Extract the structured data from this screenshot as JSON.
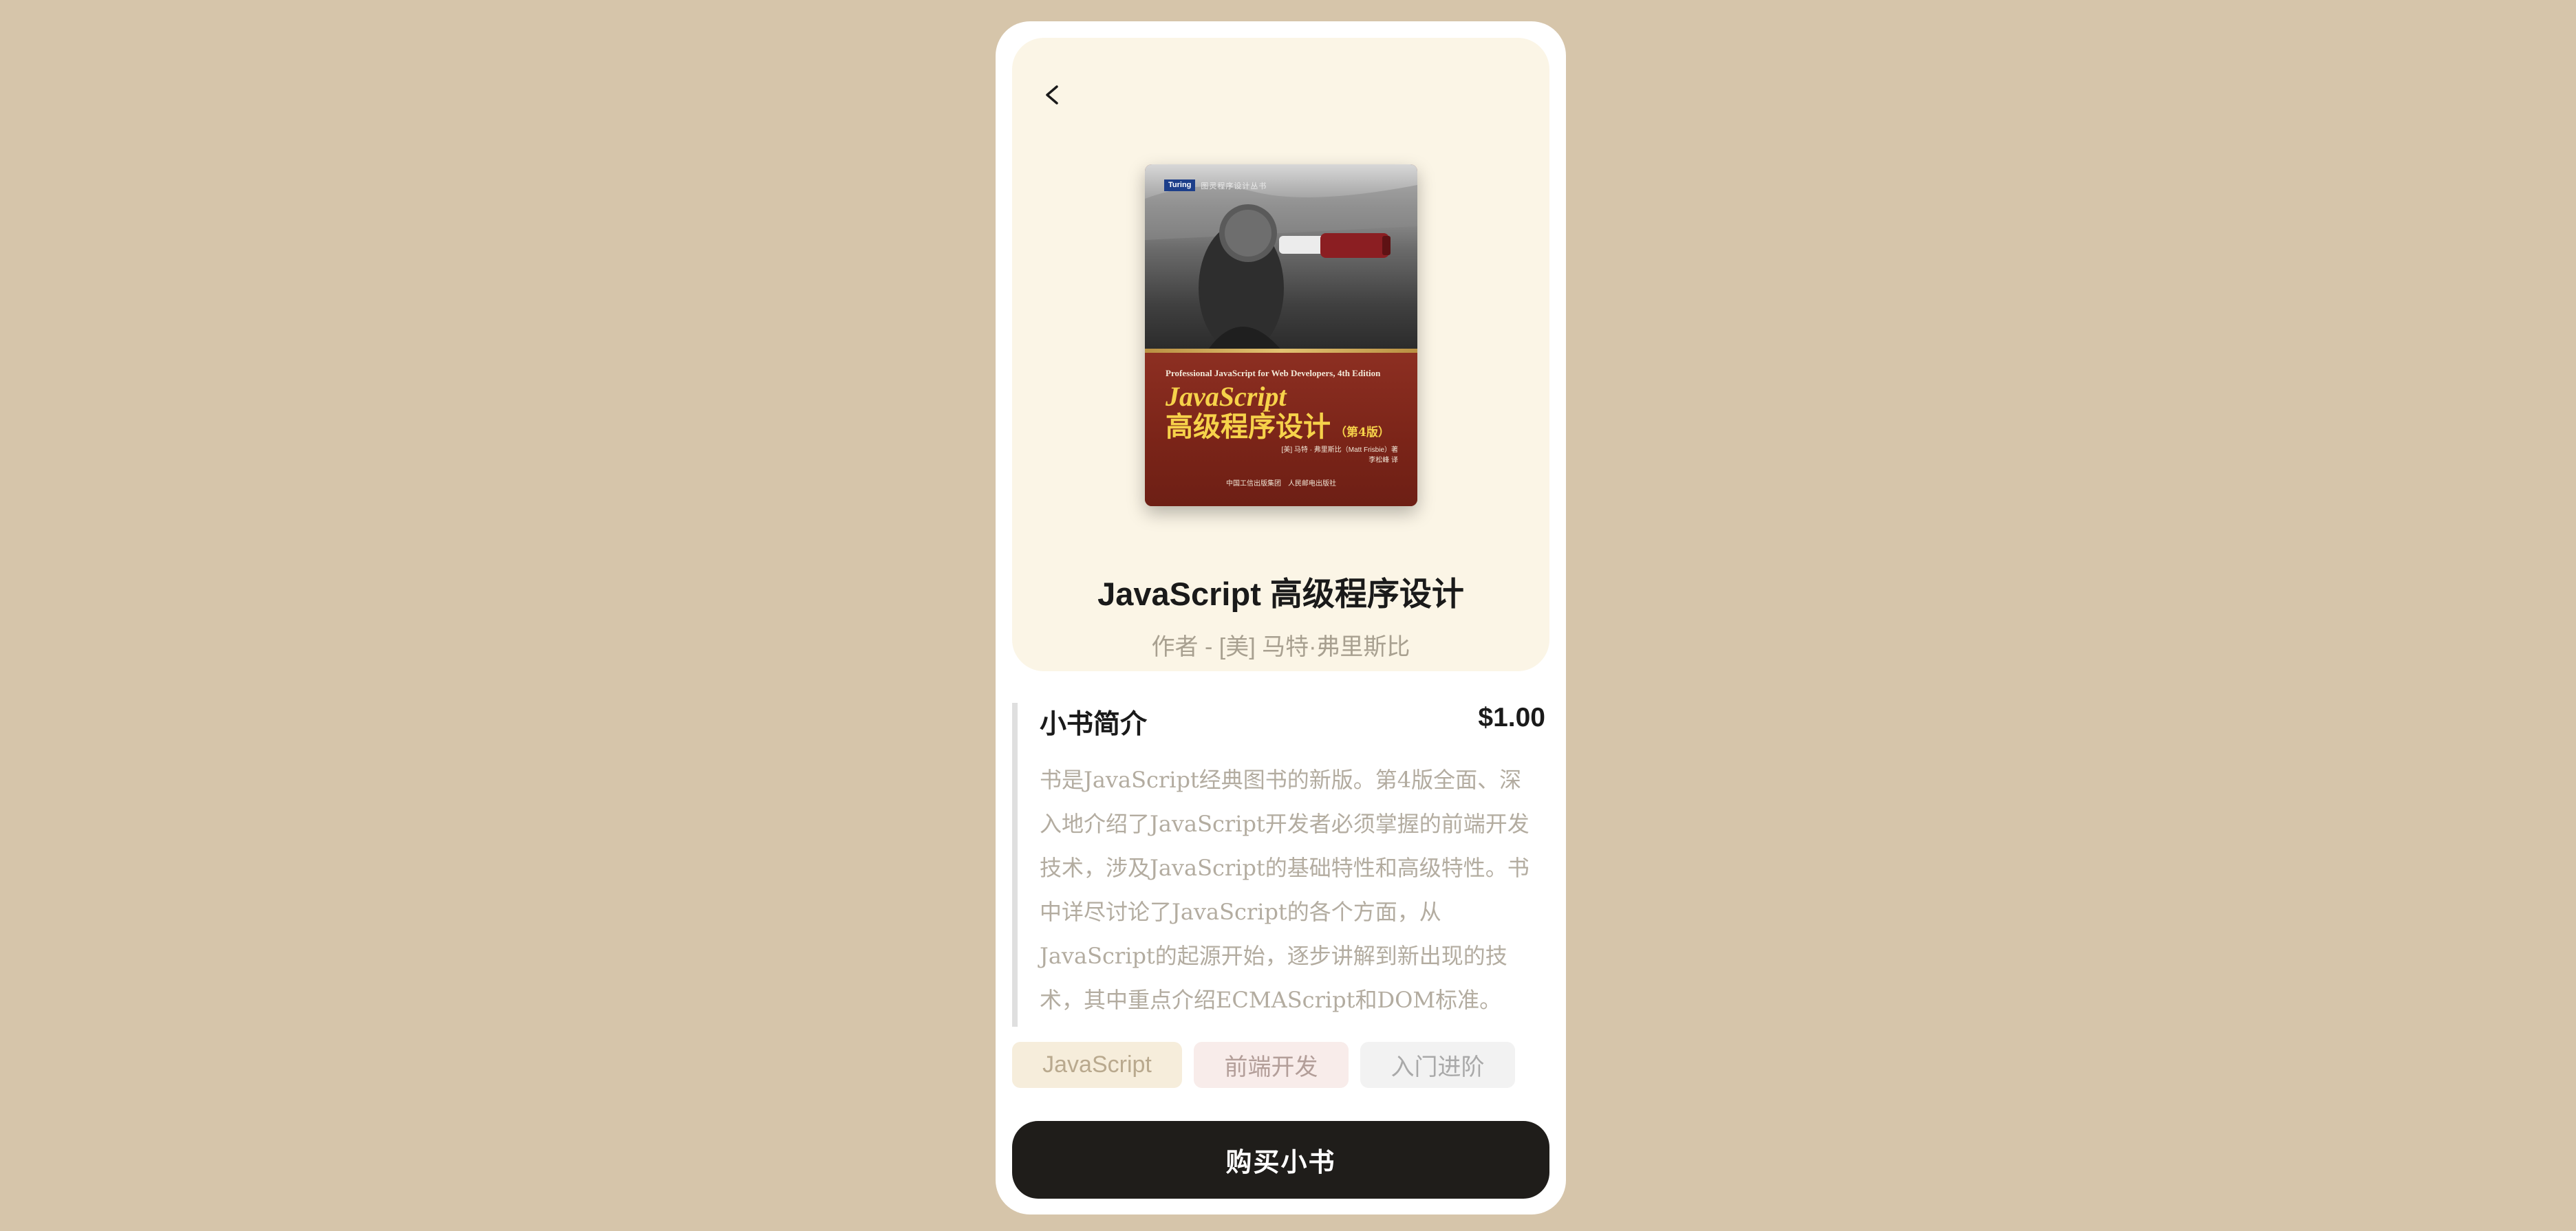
{
  "book": {
    "title": "JavaScript 高级程序设计",
    "author": "作者 - [美] 马特·弗里斯比"
  },
  "cover": {
    "series_logo": "Turing",
    "series_text": "图灵程序设计丛书",
    "subtitle_en": "Professional JavaScript for Web Developers, 4th Edition",
    "title_en": "JavaScript",
    "title_cn": "高级程序设计",
    "edition": "（第4版）",
    "author_line": "[美] 马特 · 弗里斯比（Matt Frisbie）著",
    "translator_line": "李松峰 译",
    "publisher": "中国工信出版集团　人民邮电出版社"
  },
  "intro": {
    "heading": "小书简介",
    "price": "$1.00",
    "text": "书是JavaScript经典图书的新版。第4版全面、深入地介绍了JavaScript开发者必须掌握的前端开发技术，涉及JavaScript的基础特性和高级特性。书中详尽讨论了JavaScript的各个方面，从JavaScript的起源开始，逐步讲解到新出现的技术，其中重点介绍ECMAScript和DOM标准。"
  },
  "tags": [
    "JavaScript",
    "前端开发",
    "入门进阶"
  ],
  "actions": {
    "buy_label": "购买小书"
  },
  "icons": {
    "back": "chevron-left-icon"
  },
  "colors": {
    "background": "#d6c5aa",
    "hero": "#fbf5e6",
    "button": "#1f1d1a"
  }
}
